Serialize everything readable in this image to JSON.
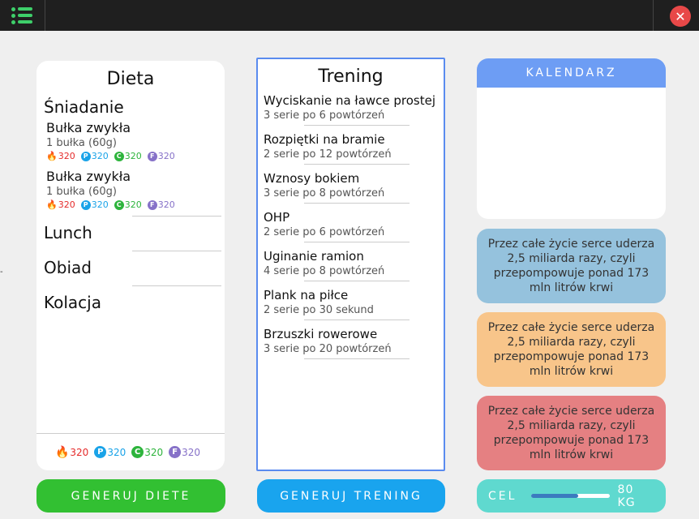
{
  "window": {
    "menu_icon": "menu-list-icon",
    "close_icon": "close-icon",
    "close_glyph": "✕"
  },
  "diet": {
    "title": "Dieta",
    "meals": [
      {
        "name": "Śniadanie",
        "foods": [
          {
            "name": "Bułka zwykła",
            "qty": "1 bułka (60g)",
            "kcal": "320",
            "p": "320",
            "c": "320",
            "f": "320"
          },
          {
            "name": "Bułka zwykła",
            "qty": "1 bułka (60g)",
            "kcal": "320",
            "p": "320",
            "c": "320",
            "f": "320"
          }
        ]
      },
      {
        "name": "Lunch",
        "foods": []
      },
      {
        "name": "Obiad",
        "foods": []
      },
      {
        "name": "Kolacja",
        "foods": []
      }
    ],
    "totals": {
      "kcal": "320",
      "p": "320",
      "c": "320",
      "f": "320"
    },
    "macro_letters": {
      "p": "P",
      "c": "C",
      "f": "F"
    }
  },
  "training": {
    "title": "Trening",
    "exercises": [
      {
        "name": "Wyciskanie na ławce prostej",
        "sets": "3 serie po 6 powtórzeń"
      },
      {
        "name": "Rozpiętki na bramie",
        "sets": "2 serie po 12 powtórzeń"
      },
      {
        "name": "Wznosy bokiem",
        "sets": "3 serie po 8 powtórzeń"
      },
      {
        "name": "OHP",
        "sets": "2 serie po 6 powtórzeń"
      },
      {
        "name": "Uginanie ramion",
        "sets": "4 serie po 8 powtórzeń"
      },
      {
        "name": "Plank na piłce",
        "sets": "2 serie po 30 sekund"
      },
      {
        "name": "Brzuszki rowerowe",
        "sets": "3 serie po 20 powtórzeń"
      }
    ]
  },
  "calendar": {
    "title": "KALENDARZ"
  },
  "facts": [
    {
      "text": "Przez całe życie serce uderza 2,5 miliarda razy, czyli przepompowuje ponad 173 mln litrów krwi",
      "color": "#95c2dd"
    },
    {
      "text": "Przez całe życie serce uderza 2,5 miliarda razy, czyli przepompowuje ponad 173 mln litrów krwi",
      "color": "#f8c58a"
    },
    {
      "text": "Przez całe życie serce uderza 2,5 miliarda razy, czyli przepompowuje ponad 173 mln litrów krwi",
      "color": "#e58082"
    }
  ],
  "buttons": {
    "diet": "GENERUJ DIETE",
    "training": "GENERUJ TRENING"
  },
  "goal": {
    "label": "CEL",
    "value": "80 KG",
    "progress": 0.6
  },
  "edge_mark": "-"
}
